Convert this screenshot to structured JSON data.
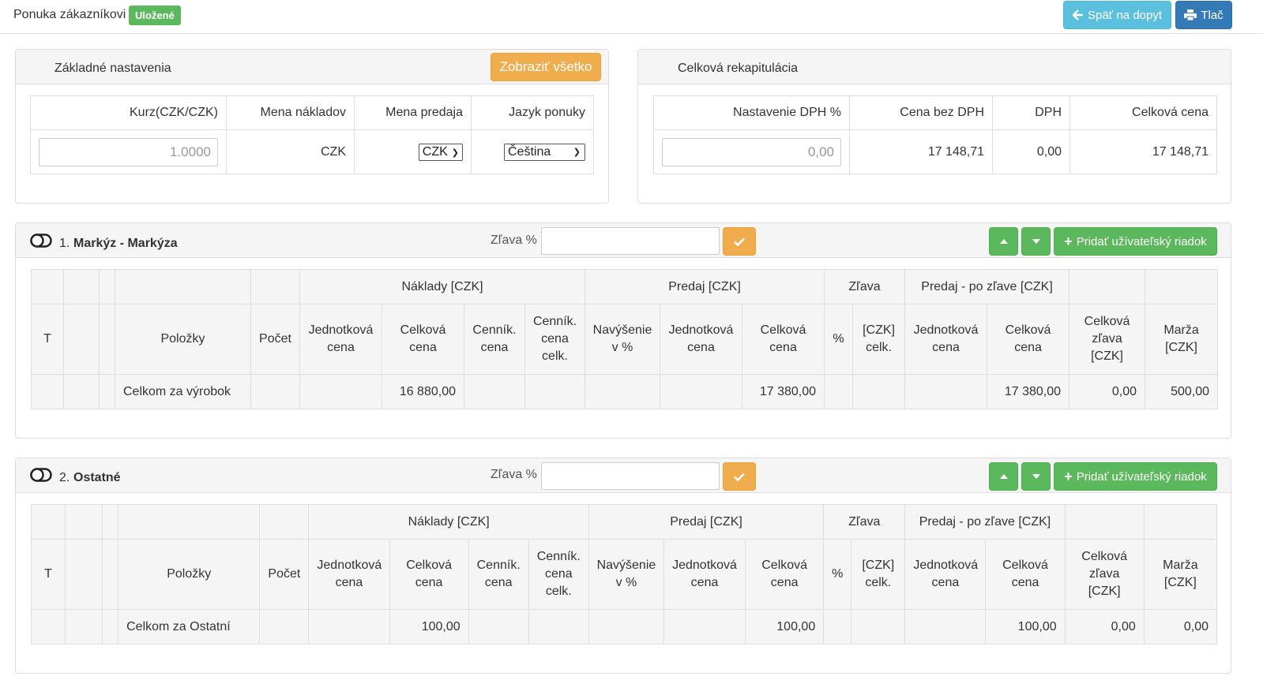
{
  "header": {
    "title": "Ponuka zákazníkovi",
    "status_badge": "Uložené",
    "back_button": "Späť na dopyt",
    "print_button": "Tlač"
  },
  "basic_settings": {
    "title": "Základné nastavenia",
    "show_all_button": "Zobraziť všetko",
    "columns": [
      "Kurz(CZK/CZK)",
      "Mena nákladov",
      "Mena predaja",
      "Jazyk ponuky"
    ],
    "rate_value": "1.0000",
    "cost_currency": "CZK",
    "sale_currency": "CZK",
    "language": "Čeština"
  },
  "recap": {
    "title": "Celková rekapitulácia",
    "columns": [
      "Nastavenie DPH %",
      "Cena bez DPH",
      "DPH",
      "Celková cena"
    ],
    "vat_percent": "0,00",
    "price_no_vat": "17 148,71",
    "vat": "0,00",
    "total": "17 148,71"
  },
  "table_headers": {
    "group_costs": "Náklady [CZK]",
    "group_sale": "Predaj [CZK]",
    "group_discount": "Zľava",
    "group_after_discount": "Predaj - po zľave [CZK]",
    "t": "T",
    "items": "Položky",
    "count": "Počet",
    "unit_price": "Jednotková cena",
    "total_price": "Celková cena",
    "list_price": "Cenník. cena",
    "list_price_total": "Cenník. cena celk.",
    "markup": "Navýšenie v %",
    "percent": "%",
    "czk_total": "[CZK] celk.",
    "total_discount": "Celková zľava [CZK]",
    "margin": "Marža [CZK]"
  },
  "sections": [
    {
      "number": "1.",
      "name": "Markýz - Markýza",
      "discount_label": "Zľava %",
      "add_row_button": "Pridať užívateľský riadok",
      "total_label": "Celkom za výrobok",
      "cost_total": "16 880,00",
      "sale_total": "17 380,00",
      "after_discount_total": "17 380,00",
      "total_discount": "0,00",
      "margin": "500,00"
    },
    {
      "number": "2.",
      "name": "Ostatné",
      "discount_label": "Zľava %",
      "add_row_button": "Pridať užívateľský riadok",
      "total_label": "Celkom za Ostatní",
      "cost_total": "100,00",
      "sale_total": "100,00",
      "after_discount_total": "100,00",
      "total_discount": "0,00",
      "margin": "0,00"
    }
  ]
}
